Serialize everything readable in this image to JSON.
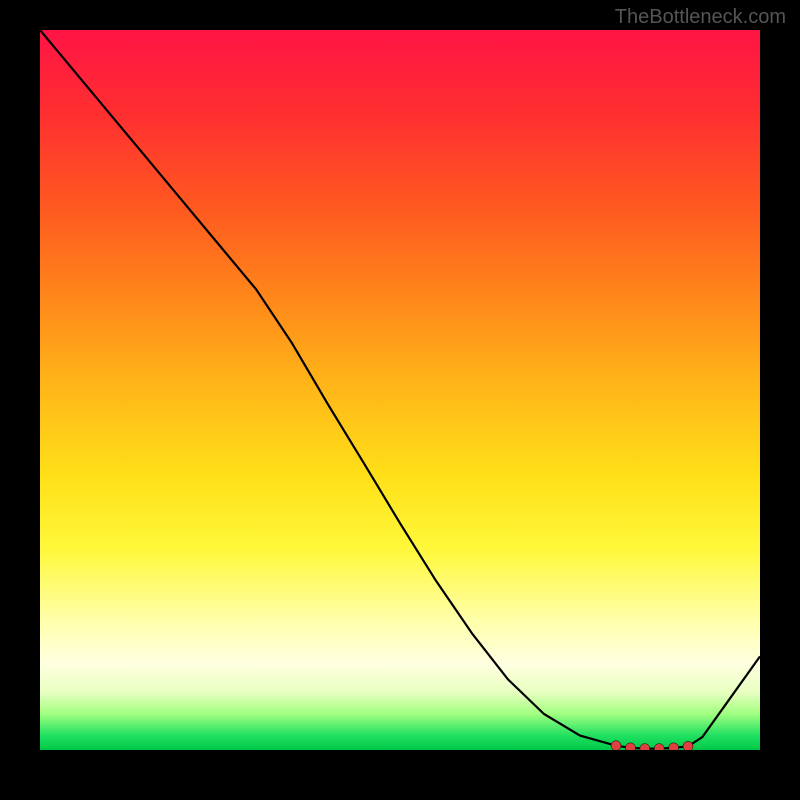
{
  "watermark": "TheBottleneck.com",
  "chart_data": {
    "type": "line",
    "x": [
      0.0,
      0.05,
      0.1,
      0.15,
      0.2,
      0.25,
      0.3,
      0.35,
      0.4,
      0.45,
      0.5,
      0.55,
      0.6,
      0.65,
      0.7,
      0.75,
      0.8,
      0.82,
      0.84,
      0.86,
      0.88,
      0.9,
      0.92,
      0.95,
      1.0
    ],
    "y": [
      1.0,
      0.94,
      0.88,
      0.82,
      0.76,
      0.7,
      0.64,
      0.565,
      0.48,
      0.398,
      0.315,
      0.235,
      0.162,
      0.098,
      0.05,
      0.02,
      0.006,
      0.003,
      0.002,
      0.002,
      0.003,
      0.005,
      0.018,
      0.06,
      0.13
    ],
    "markers": {
      "x": [
        0.8,
        0.82,
        0.84,
        0.86,
        0.88,
        0.9
      ],
      "y": [
        0.006,
        0.003,
        0.002,
        0.002,
        0.003,
        0.005
      ]
    },
    "title": "",
    "xlabel": "",
    "ylabel": "",
    "xlim": [
      0,
      1
    ],
    "ylim": [
      0,
      1
    ],
    "grid": false,
    "legend": false,
    "notes": "Bottleneck curve: vertical gradient red→yellow→green, black line from top-left descending to a minimum near x≈0.85 then rising; red dot markers cluster at the minimum."
  }
}
